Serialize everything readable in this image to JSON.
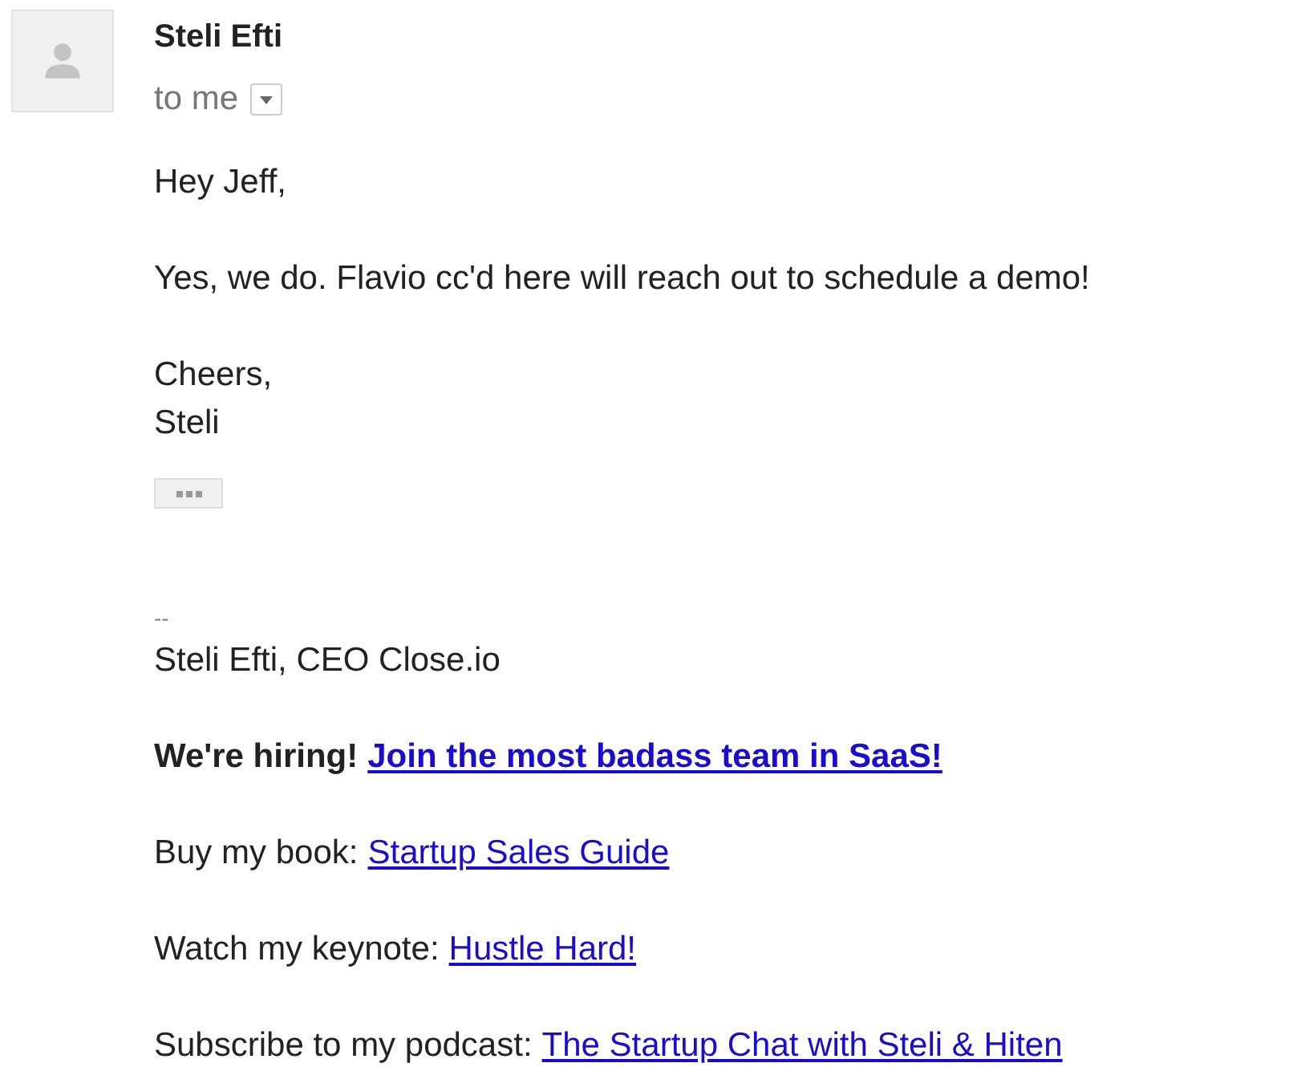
{
  "sender": {
    "name": "Steli Efti",
    "recipient": "to me"
  },
  "body": [
    [
      "Hey Jeff,"
    ],
    [
      "Yes, we do. Flavio cc'd here will reach out to schedule a demo!"
    ],
    [
      "Cheers,",
      "Steli"
    ]
  ],
  "signature": {
    "separator": "--",
    "name_line": "Steli Efti, CEO Close.io",
    "links": [
      {
        "label": "We're hiring!",
        "link": "Join the most badass team in SaaS!",
        "bold": true
      },
      {
        "label": "Buy my book:",
        "link": "Startup Sales Guide",
        "bold": false
      },
      {
        "label": "Watch my keynote:",
        "link": "Hustle Hard!",
        "bold": false
      },
      {
        "label": "Subscribe to my podcast:",
        "link": "The Startup Chat with Steli & Hiten",
        "bold": false
      }
    ]
  }
}
